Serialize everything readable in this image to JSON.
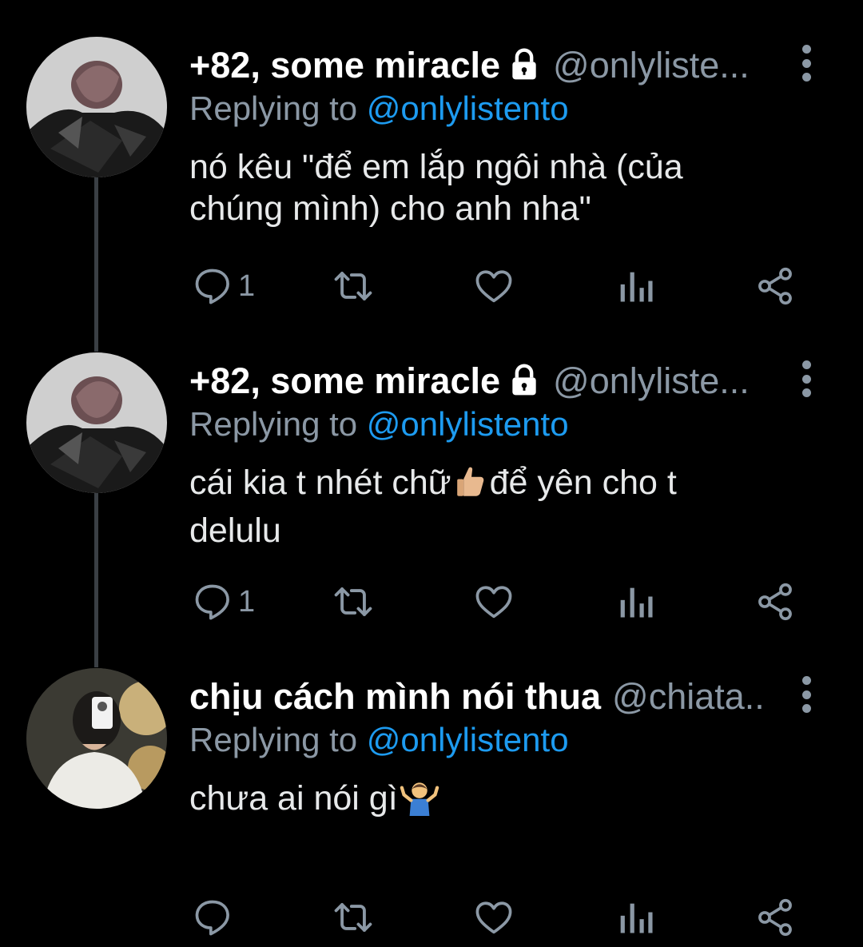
{
  "colors": {
    "background": "#000000",
    "name_text": "#ffffff",
    "secondary_text": "#8b98a5",
    "link": "#1d9bf0",
    "thread_line": "#3a3f44"
  },
  "tweets": [
    {
      "display_name": "+82, some miracle",
      "protected_icon": "lock-icon",
      "handle": "@onlyliste...",
      "replying_prefix": "Replying to",
      "replying_handle": "@onlylistento",
      "body_line1": "nó kêu \"để em lắp ngôi nhà (của",
      "body_line2": "chúng mình) cho anh nha\"",
      "reply_count": "1",
      "avatar": "avatar-dark-jacket"
    },
    {
      "display_name": "+82, some miracle",
      "protected_icon": "lock-icon",
      "handle": "@onlyliste...",
      "replying_prefix": "Replying to",
      "replying_handle": "@onlylistento",
      "body_before_emoji": "cái kia t nhét chữ",
      "emoji": "thumbs-up-emoji",
      "body_after_emoji": "để yên cho t",
      "body_line2": "delulu",
      "reply_count": "1",
      "avatar": "avatar-dark-jacket"
    },
    {
      "display_name": "chịu cách mình nói thua",
      "handle": "@chiata...",
      "replying_prefix": "Replying to",
      "replying_handle": "@onlylistento",
      "body_text": "chưa ai nói gì",
      "emoji": "person-shrugging-emoji",
      "reply_count": "",
      "avatar": "avatar-mirror-selfie"
    }
  ],
  "action_icons": [
    "reply-icon",
    "retweet-icon",
    "like-icon",
    "analytics-icon",
    "share-icon"
  ]
}
